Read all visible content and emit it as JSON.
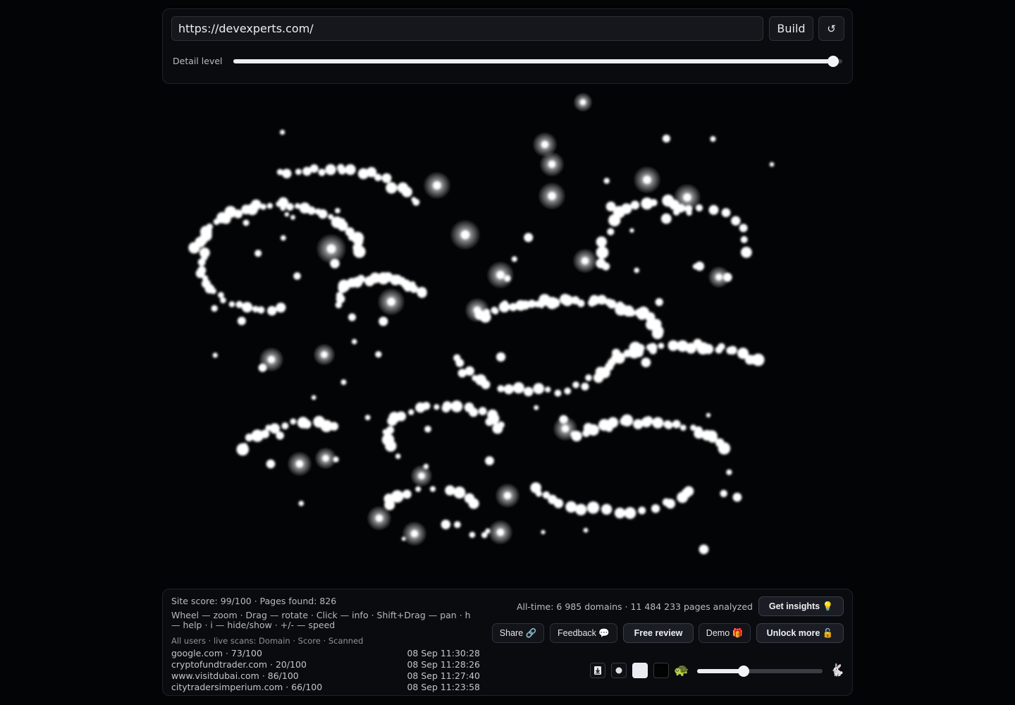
{
  "toolbar": {
    "url_value": "https://devexperts.com/",
    "build_label": "Build",
    "refresh_icon": "↺",
    "detail_label": "Detail level",
    "detail_level": 0.985
  },
  "stats": {
    "site_line": "Site score: 99/100 · Pages found: 826",
    "controls_help": "Wheel — zoom · Drag — rotate · Click — info · Shift+Drag — pan · h — help · i — hide/show · +/- — speed",
    "live_header": "All users · live scans: Domain · Score · Scanned",
    "all_time": "All-time: 6 985 domains · 11 484 233 pages analyzed"
  },
  "live_scans": [
    {
      "domain_score": "google.com · 73/100",
      "scanned": "08 Sep 11:30:28"
    },
    {
      "domain_score": "cryptofundtrader.com · 20/100",
      "scanned": "08 Sep 11:28:26"
    },
    {
      "domain_score": "www.visitdubai.com · 86/100",
      "scanned": "08 Sep 11:27:40"
    },
    {
      "domain_score": "citytradersimperium.com · 66/100",
      "scanned": "08 Sep 11:23:58"
    }
  ],
  "actions": {
    "insights": "Get insights 💡",
    "share": "Share 🔗",
    "feedback": "Feedback 💬",
    "free_review": "Free review",
    "demo": "Demo 🎁",
    "unlock": "Unlock more 🔓"
  },
  "playback": {
    "slow_icon": "🐢",
    "fast_icon": "🐇",
    "speed_level": 0.37
  },
  "colors": {
    "background": "#030406",
    "node": "#ffffff"
  }
}
